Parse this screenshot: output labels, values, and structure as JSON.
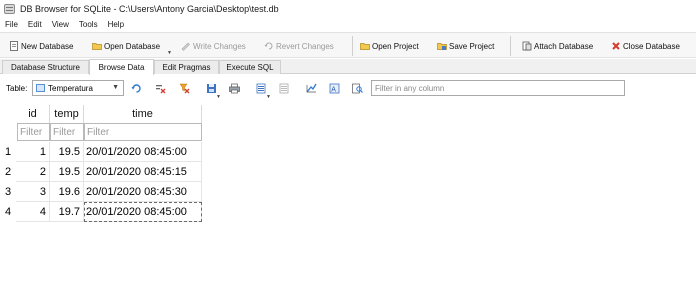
{
  "window": {
    "title": "DB Browser for SQLite - C:\\Users\\Antony Garcia\\Desktop\\test.db"
  },
  "menu": [
    "File",
    "Edit",
    "View",
    "Tools",
    "Help"
  ],
  "toolbar": {
    "new_db": "New Database",
    "open_db": "Open Database",
    "write_changes": "Write Changes",
    "revert_changes": "Revert Changes",
    "open_project": "Open Project",
    "save_project": "Save Project",
    "attach_db": "Attach Database",
    "close_db": "Close Database"
  },
  "tabs": [
    {
      "label": "Database Structure",
      "active": false
    },
    {
      "label": "Browse Data",
      "active": true
    },
    {
      "label": "Edit Pragmas",
      "active": false
    },
    {
      "label": "Execute SQL",
      "active": false
    }
  ],
  "browse": {
    "table_label": "Table:",
    "table_value": "Temperatura",
    "filter_all_placeholder": "Filter in any column"
  },
  "grid": {
    "columns": [
      "id",
      "temp",
      "time"
    ],
    "filter_placeholder": "Filter",
    "rows": [
      {
        "rownum": "1",
        "id": "1",
        "temp": "19.5",
        "time": "20/01/2020 08:45:00"
      },
      {
        "rownum": "2",
        "id": "2",
        "temp": "19.5",
        "time": "20/01/2020 08:45:15"
      },
      {
        "rownum": "3",
        "id": "3",
        "temp": "19.6",
        "time": "20/01/2020 08:45:30"
      },
      {
        "rownum": "4",
        "id": "4",
        "temp": "19.7",
        "time": "20/01/2020 08:45:00"
      }
    ]
  }
}
